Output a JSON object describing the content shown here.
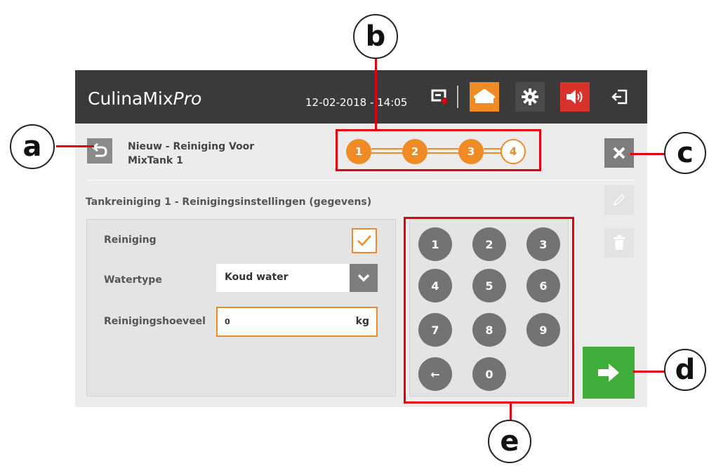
{
  "topbar": {
    "brand_main": "CulinaMix",
    "brand_italic": "Pro",
    "datetime": "12-02-2018 - 14:05",
    "icons": [
      "monitor-record-icon",
      "home-icon",
      "gear-icon",
      "speaker-icon",
      "logout-icon"
    ],
    "colors": {
      "background": "#3a3a3a",
      "home": "#f08a24",
      "speaker": "#d9322b"
    }
  },
  "header": {
    "title_line1": "Nieuw - Reiniging Voor",
    "title_line2": "MixTank 1",
    "steps": [
      {
        "label": "1",
        "state": "done"
      },
      {
        "label": "2",
        "state": "done"
      },
      {
        "label": "3",
        "state": "done"
      },
      {
        "label": "4",
        "state": "current"
      }
    ]
  },
  "section_title": "Tankreiniging 1 - Reinigingsinstellingen (gegevens)",
  "form": {
    "cleaning_label": "Reiniging",
    "cleaning_checked": true,
    "watertype_label": "Watertype",
    "watertype_value": "Koud water",
    "amount_label": "Reinigingshoeveel",
    "amount_value": "0",
    "amount_unit": "kg"
  },
  "keypad": {
    "keys": [
      "1",
      "2",
      "3",
      "4",
      "5",
      "6",
      "7",
      "8",
      "9",
      "←",
      "0"
    ]
  },
  "callouts": {
    "a": "a",
    "b": "b",
    "c": "c",
    "d": "d",
    "e": "e"
  },
  "colors": {
    "accent": "#f08a24",
    "next": "#3fae3a",
    "annotation": "#e3000f"
  }
}
